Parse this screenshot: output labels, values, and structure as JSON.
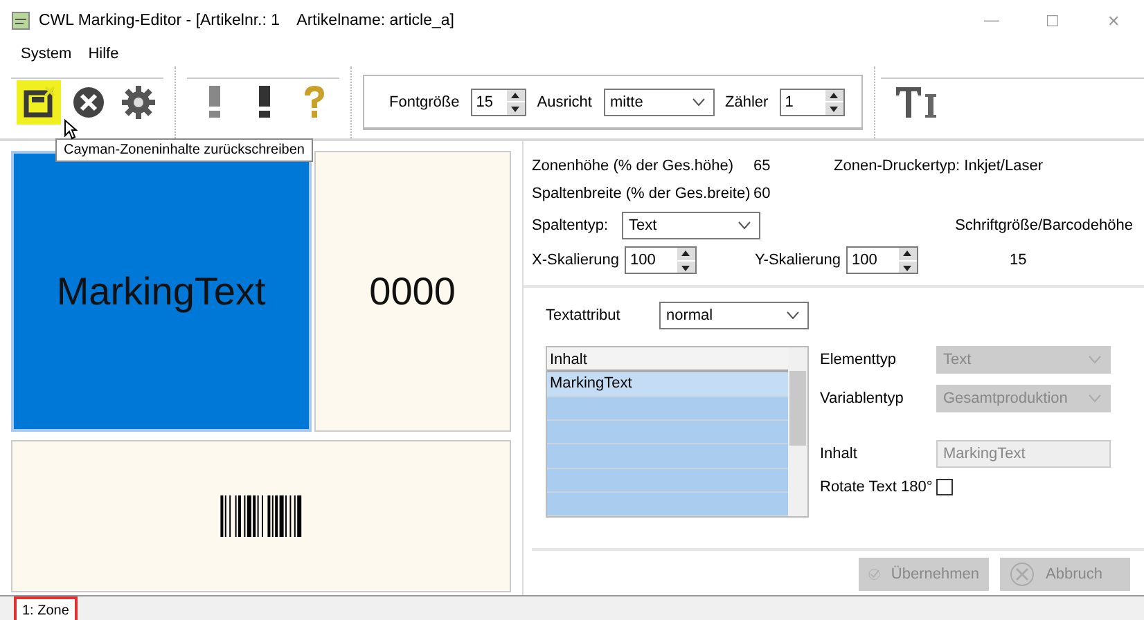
{
  "window": {
    "title": "CWL Marking-Editor - [Artikelnr.: 1    Artikelname: article_a]",
    "controls": [
      "—",
      "☐",
      "✕"
    ]
  },
  "menu": [
    "System",
    "Hilfe"
  ],
  "toolbar": {
    "groups": [
      [
        {
          "kind": "save",
          "hovered": true
        },
        {
          "kind": "cancel",
          "hovered": false
        },
        {
          "kind": "settings",
          "hovered": false
        }
      ],
      [
        {
          "kind": "warn-light",
          "hovered": false
        },
        {
          "kind": "warn-dark",
          "hovered": false
        },
        {
          "kind": "help",
          "hovered": false
        }
      ]
    ],
    "tooltip": "Cayman-Zoneninhalte zurückschreiben",
    "format": {
      "fontsize_label": "Fontgröße",
      "fontsize": "15",
      "align_label": "Ausricht",
      "align": "mitte",
      "counter_label": "Zähler",
      "counter": "1"
    },
    "text_tool": {
      "kind": "text-tool"
    }
  },
  "zone_rows": [
    [
      {
        "kind": "text",
        "text": "MarkingText",
        "selected": true
      },
      {
        "kind": "text",
        "text": "0000",
        "selected": false
      }
    ],
    [
      {
        "kind": "barcode",
        "selected": false
      }
    ]
  ],
  "properties": {
    "info": [
      {
        "label": "Zonenhöhe (% der Ges.höhe)",
        "value": "65"
      },
      {
        "label": "Spaltenbreite (% der Ges.breite)",
        "value": "60"
      }
    ],
    "printer_type": "Zonen-Druckertyp: Inkjet/Laser",
    "column_type_label": "Spaltentyp:",
    "column_type": "Text",
    "size_label": "Schriftgröße/Barcodehöhe",
    "size": "15",
    "x_scale_label": "X-Skalierung",
    "x_scale": "100",
    "y_scale_label": "Y-Skalierung",
    "y_scale": "100",
    "text_attr_label": "Textattribut",
    "text_attr": "normal",
    "list": {
      "header": "Inhalt",
      "rows": [
        {
          "text": "MarkingText",
          "selected": true
        }
      ]
    },
    "element_type_label": "Elementtyp",
    "element_type": "Text",
    "element_type_disabled": true,
    "variable_type_label": "Variablentyp",
    "variable_type": "Gesamtproduktion",
    "variable_type_disabled": true,
    "content_label": "Inhalt",
    "content": "MarkingText",
    "content_disabled": true,
    "rotate_label": "Rotate Text 180°",
    "rotate_checked": false,
    "buttons": [
      {
        "kind": "ok",
        "label": "Übernehmen",
        "disabled": true
      },
      {
        "kind": "cancel",
        "label": "Abbruch",
        "disabled": true
      }
    ]
  },
  "tabs": [
    {
      "label": "1: Zone",
      "selected": true
    }
  ]
}
